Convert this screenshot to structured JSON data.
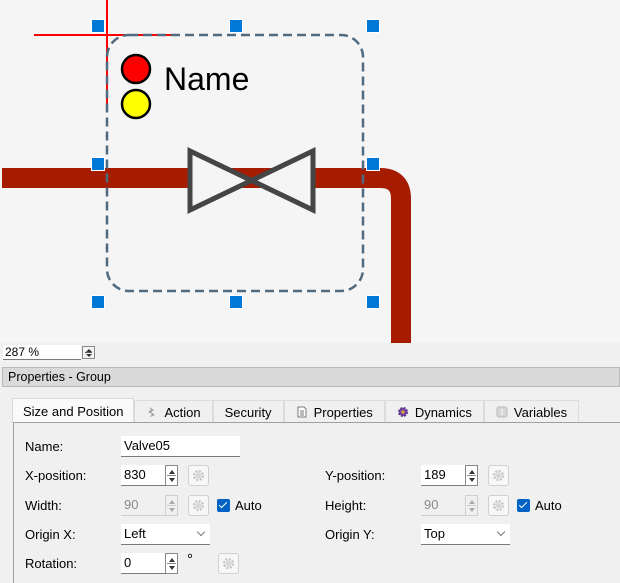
{
  "canvas": {
    "label_text": "Name",
    "colors": {
      "pipe": "#a61c00",
      "guide": "#ff0000",
      "selection_border": "#506a80",
      "valve_stroke": "#454545",
      "indicator_red": "#ff0000",
      "indicator_yellow": "#ffff00",
      "handle": "#0078d7"
    }
  },
  "zoom": {
    "value": "287 %"
  },
  "properties": {
    "header": "Properties - Group",
    "tabs": [
      {
        "label": "Size and Position",
        "icon": "none",
        "active": true
      },
      {
        "label": "Action",
        "icon": "action-icon"
      },
      {
        "label": "Security",
        "icon": "none"
      },
      {
        "label": "Properties",
        "icon": "document-icon"
      },
      {
        "label": "Dynamics",
        "icon": "dynamics-gear-icon"
      },
      {
        "label": "Variables",
        "icon": "variables-icon"
      }
    ],
    "fields": {
      "name_label": "Name:",
      "name_value": "Valve05",
      "x_label": "X-position:",
      "x_value": "830",
      "y_label": "Y-position:",
      "y_value": "189",
      "width_label": "Width:",
      "width_value": "90",
      "width_auto_label": "Auto",
      "width_auto_checked": true,
      "height_label": "Height:",
      "height_value": "90",
      "height_auto_label": "Auto",
      "height_auto_checked": true,
      "origin_x_label": "Origin X:",
      "origin_x_value": "Left",
      "origin_y_label": "Origin Y:",
      "origin_y_value": "Top",
      "rotation_label": "Rotation:",
      "rotation_value": "0",
      "rotation_unit": "°"
    }
  }
}
